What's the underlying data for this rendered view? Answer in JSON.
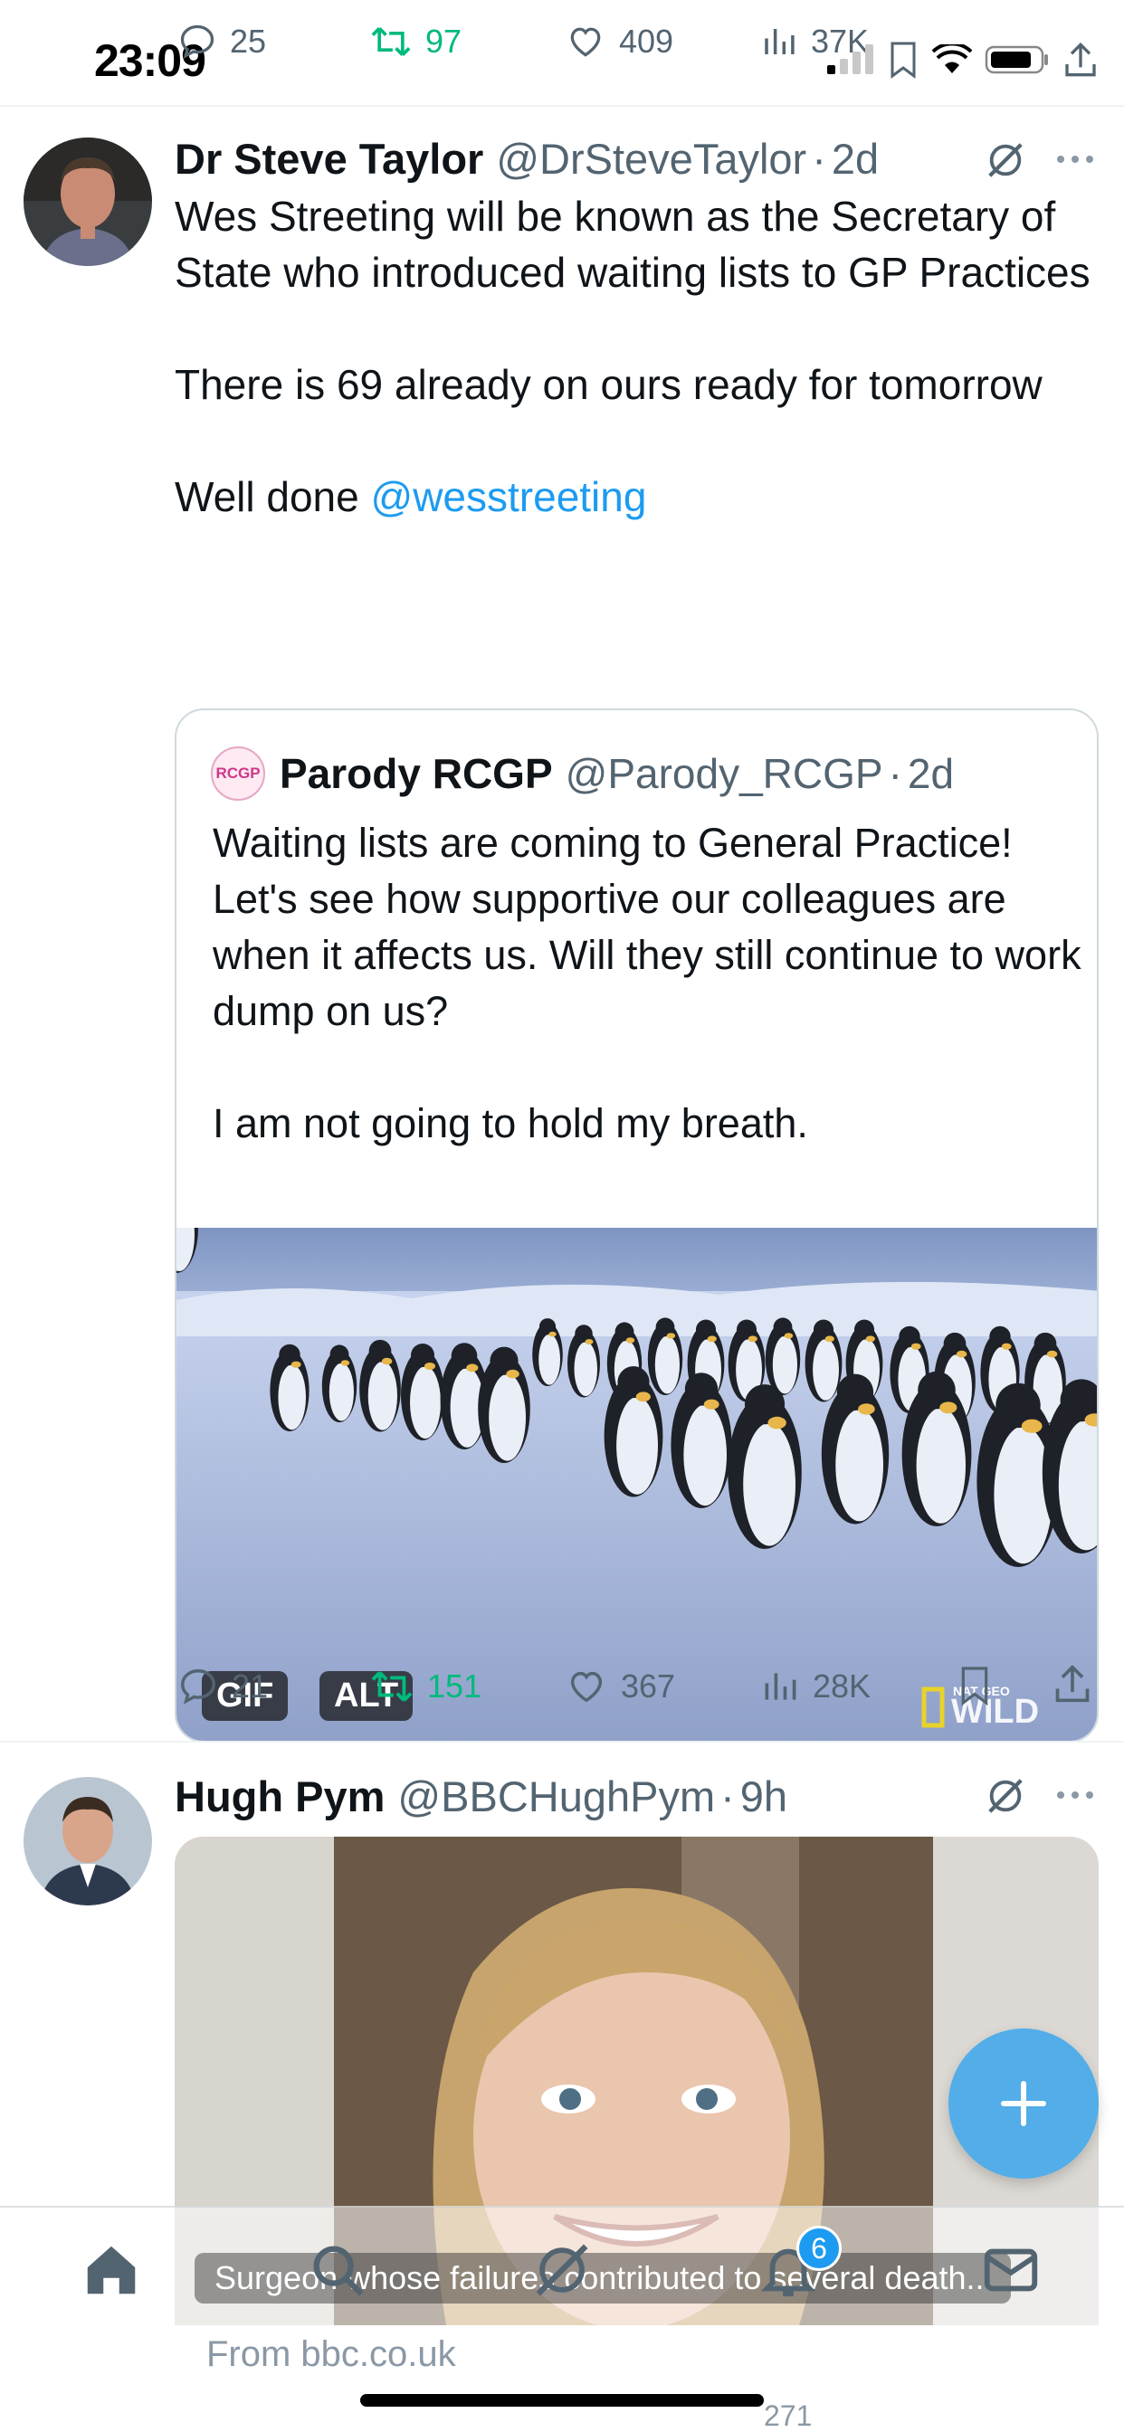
{
  "status_bar": {
    "time": "23:09"
  },
  "prev_tweet_actions": {
    "replies": "25",
    "reposts": "97",
    "likes": "409",
    "views": "37K"
  },
  "tweet1": {
    "author_name": "Dr Steve Taylor",
    "author_handle": "@DrSteveTaylor",
    "separator": "·",
    "time": "2d",
    "text_lines": [
      "Wes Streeting will be known as the Secretary of State who introduced waiting lists to GP Practices",
      "",
      "There is 69 already on ours ready for tomorrow",
      "",
      "Well done "
    ],
    "mention": "@wesstreeting",
    "quote": {
      "logo_text": "RCGP",
      "author_name": "Parody RCGP",
      "author_handle": "@Parody_RCGP",
      "separator": "·",
      "time": "2d",
      "text_lines": [
        "Waiting lists are coming to General Practice!",
        "Let's see how supportive our colleagues are when it affects us. Will they still continue to work dump on us?",
        "",
        "I am not going to hold my breath."
      ],
      "media": {
        "gif_badge": "GIF",
        "alt_badge": "ALT",
        "watermark": "WILD",
        "watermark_small": "NAT GEO"
      }
    },
    "actions": {
      "replies": "21",
      "reposts": "151",
      "likes": "367",
      "views": "28K"
    }
  },
  "tweet2": {
    "author_name": "Hugh Pym",
    "author_handle": "@BBCHughPym",
    "separator": "·",
    "time": "9h",
    "card_caption": "Surgeon whose failures contributed to several death...",
    "card_source": "From bbc.co.uk",
    "partial_views": "271"
  },
  "nav": {
    "notifications_count": "6"
  },
  "colors": {
    "accent": "#1d9bf0",
    "repost": "#00ba7c",
    "text_secondary": "#536471"
  },
  "icons": [
    "reply-icon",
    "repost-icon",
    "like-icon",
    "views-icon",
    "bookmark-icon",
    "share-icon",
    "grok-icon",
    "more-icon",
    "home-icon",
    "search-icon",
    "grok-nav-icon",
    "notifications-icon",
    "messages-icon",
    "compose-icon"
  ]
}
